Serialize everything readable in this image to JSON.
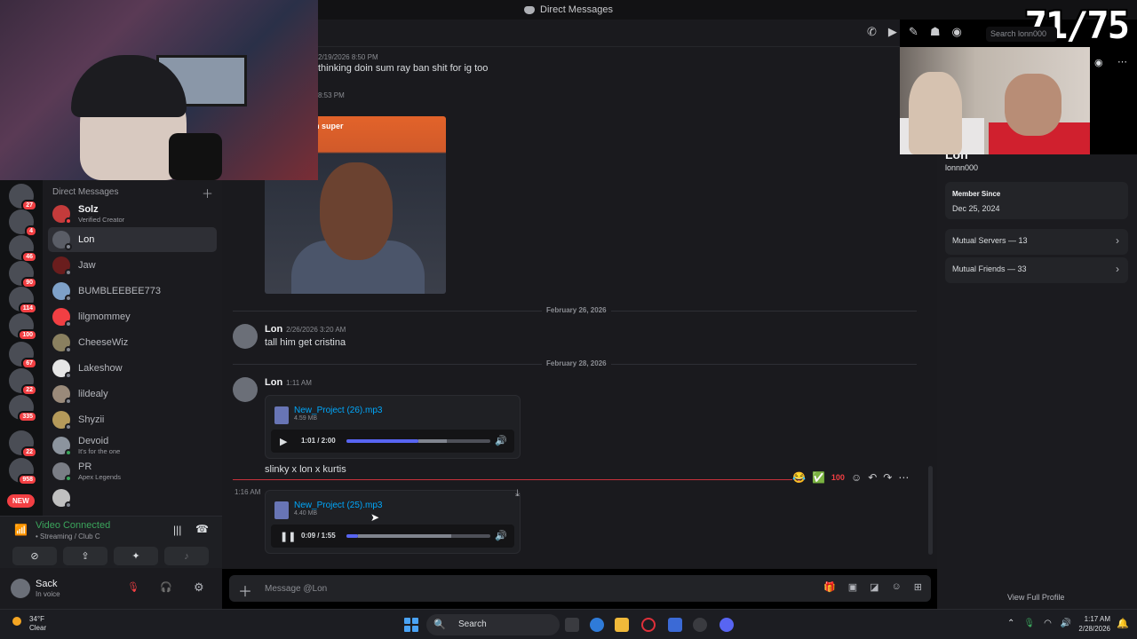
{
  "window": {
    "title": "Direct Messages"
  },
  "overlay": {
    "counter": "71/75"
  },
  "header": {
    "search_placeholder": "Search lonn000"
  },
  "servers": [
    {
      "badge": "27"
    },
    {
      "badge": "4"
    },
    {
      "badge": "46"
    },
    {
      "badge": "90"
    },
    {
      "badge": "114"
    },
    {
      "badge": "100"
    },
    {
      "badge": "67"
    },
    {
      "badge": "22"
    },
    {
      "badge": "335"
    },
    {
      "badge": "22"
    },
    {
      "badge": "958"
    }
  ],
  "servers_new_label": "NEW",
  "dm": {
    "heading": "Direct Messages",
    "items": [
      {
        "name": "Solz",
        "sub": "Verified Creator"
      },
      {
        "name": "Lon",
        "sub": ""
      },
      {
        "name": "Jaw",
        "sub": ""
      },
      {
        "name": "BUMBLEEBEE773",
        "sub": ""
      },
      {
        "name": "lilgmommey",
        "sub": ""
      },
      {
        "name": "CheeseWiz",
        "sub": ""
      },
      {
        "name": "Lakeshow",
        "sub": ""
      },
      {
        "name": "lildealy",
        "sub": ""
      },
      {
        "name": "Shyzii",
        "sub": ""
      },
      {
        "name": "Devoid",
        "sub": "It's for the one"
      },
      {
        "name": "PR",
        "sub": "Apex Legends"
      }
    ]
  },
  "voice": {
    "status": "Video Connected",
    "detail": "• Streaming / Club C"
  },
  "user": {
    "name": "Sack",
    "status": "In voice"
  },
  "messages": {
    "m1": {
      "time": "2/19/2026 8:50 PM",
      "text": "thinking doin sum ray ban shit for ig too"
    },
    "m2": {
      "time": "8:53 PM",
      "image_caption": "h super"
    },
    "divider1": "February 26, 2026",
    "m3": {
      "author": "Lon",
      "time": "2/26/2026 3:20 AM",
      "text": "tall him get cristina"
    },
    "divider2": "February 28, 2026",
    "m4": {
      "author": "Lon",
      "time": "1:11 AM",
      "file": {
        "name": "New_Project (26).mp3",
        "size": "4.59 MB",
        "time": "1:01 / 2:00",
        "progress": 0.5
      }
    },
    "m5": {
      "text": "slinky x lon x kurtis"
    },
    "m6": {
      "time": "1:16 AM",
      "file": {
        "name": "New_Project (25).mp3",
        "size": "4.40 MB",
        "time": "0:09 / 1:55",
        "progress": 0.08
      }
    }
  },
  "composer": {
    "placeholder": "Message @Lon"
  },
  "profile": {
    "name": "Lon",
    "handle": "lonnn000",
    "member_since_label": "Member Since",
    "member_since": "Dec 25, 2024",
    "mutual_servers": "Mutual Servers — 13",
    "mutual_friends": "Mutual Friends — 33",
    "view_full": "View Full Profile"
  },
  "taskbar": {
    "temp": "34°F",
    "weather": "Clear",
    "search": "Search",
    "time": "1:17 AM",
    "date": "2/28/2026"
  }
}
